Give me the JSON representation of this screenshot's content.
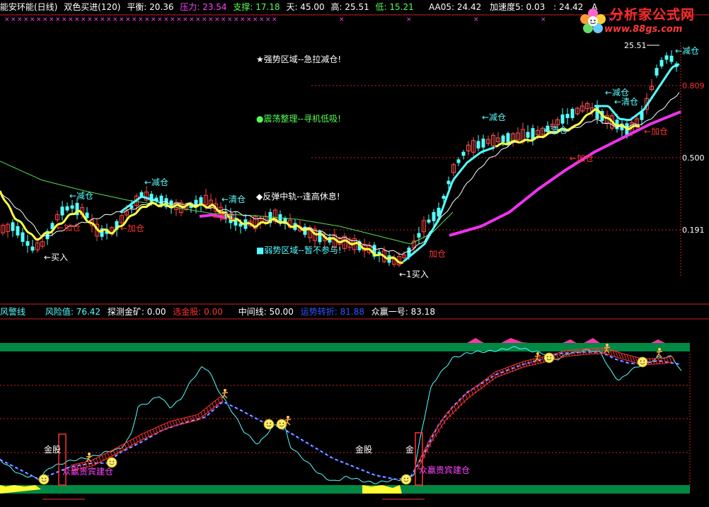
{
  "header": {
    "title": "能安环能(日线)",
    "indicator": "双色买进(120)",
    "items": [
      {
        "label": "平衡: 20.36",
        "color": "#ffffff"
      },
      {
        "label": "压力: 23.54",
        "color": "#ff44ff"
      },
      {
        "label": "支撑: 17.18",
        "color": "#55ff55"
      },
      {
        "label": "天: 45.00",
        "color": "#ffffff"
      },
      {
        "label": "高: 25.51",
        "color": "#ffffff"
      },
      {
        "label": "低: 15.21",
        "color": "#55ff55"
      }
    ],
    "right_items": [
      {
        "label": "AA05: 24.42",
        "color": "#ffffff"
      },
      {
        "label": "加速度5: 0.03",
        "color": "#ffffff"
      },
      {
        "label": ": 24.42",
        "color": "#ffffff"
      },
      {
        "label": "A",
        "color": "#ffffff"
      }
    ]
  },
  "sub_header": {
    "title": "风警线",
    "items": [
      {
        "label": "风险值: 76.42",
        "color": "#55ffff"
      },
      {
        "label": "探测金矿: 0.00",
        "color": "#ffffff"
      },
      {
        "label": "选金股: 0.00",
        "color": "#ff3333"
      },
      {
        "label": "中间线: 50.00",
        "color": "#ffffff"
      },
      {
        "label": "运势转折: 81.88",
        "color": "#3355ff"
      },
      {
        "label": "众赢一号: 83.18",
        "color": "#ffffff"
      }
    ]
  },
  "logo": {
    "title": "分析家公式网",
    "url": "www.88gs.com"
  },
  "chart_data": [
    {
      "type": "candlestick",
      "title": "能安环能(日线)",
      "high_label": "25.51",
      "axis_labels": [
        "0.809",
        "0.500",
        "0.191"
      ],
      "annotations": [
        {
          "text": "★强势区域--急拉减仓!",
          "color": "#ffffff"
        },
        {
          "text": "●震荡整理--寻机低吸!",
          "color": "#55ff55"
        },
        {
          "text": "◆反弹中轨--逢高休息!",
          "color": "#ffffff"
        },
        {
          "text": "■弱势区域--暂不参与!",
          "color": "#55ffff"
        }
      ],
      "signals": [
        {
          "text": "←买入",
          "color": "#ffffff"
        },
        {
          "text": "←加仓",
          "color": "#ff3333"
        },
        {
          "text": "←减仓",
          "color": "#55ffff"
        },
        {
          "text": "←减仓",
          "color": "#55ffff"
        },
        {
          "text": "←加仓",
          "color": "#ff3333"
        },
        {
          "text": "←清仓",
          "color": "#55ffff"
        },
        {
          "text": "←加仓",
          "color": "#ff3333"
        },
        {
          "text": "←1买入",
          "color": "#ffffff"
        },
        {
          "text": "加仓",
          "color": "#ff3333"
        },
        {
          "text": "←减仓",
          "color": "#55ffff"
        },
        {
          "text": "←清仓",
          "color": "#55ffff"
        },
        {
          "text": "←加仓",
          "color": "#ff3333"
        },
        {
          "text": "←减仓",
          "color": "#55ffff"
        },
        {
          "text": "←清仓",
          "color": "#55ffff"
        },
        {
          "text": "←加仓",
          "color": "#ff3333"
        },
        {
          "text": "←减仓",
          "color": "#55ffff"
        }
      ],
      "series": [
        {
          "color": "#ffff44"
        },
        {
          "color": "#55ffff"
        },
        {
          "color": "#ffffff"
        },
        {
          "color": "#55dd55"
        },
        {
          "color": "#ee33ee"
        }
      ]
    },
    {
      "type": "line",
      "title": "风警线",
      "labels": [
        {
          "text": "金股",
          "color": "#ffffff"
        },
        {
          "text": "金股",
          "color": "#ffffff"
        },
        {
          "text": "金",
          "color": "#ffffff"
        },
        {
          "text": "众赢贵宾建仓",
          "color": "#ff44ff"
        },
        {
          "text": "众赢贵宾建仓",
          "color": "#ff44ff"
        }
      ],
      "series": [
        {
          "name": "风险值",
          "color": "#55ffff"
        },
        {
          "name": "运势转折",
          "color": "#3355ff"
        },
        {
          "name": "众赢一号",
          "color": "#ffffff"
        }
      ]
    }
  ]
}
